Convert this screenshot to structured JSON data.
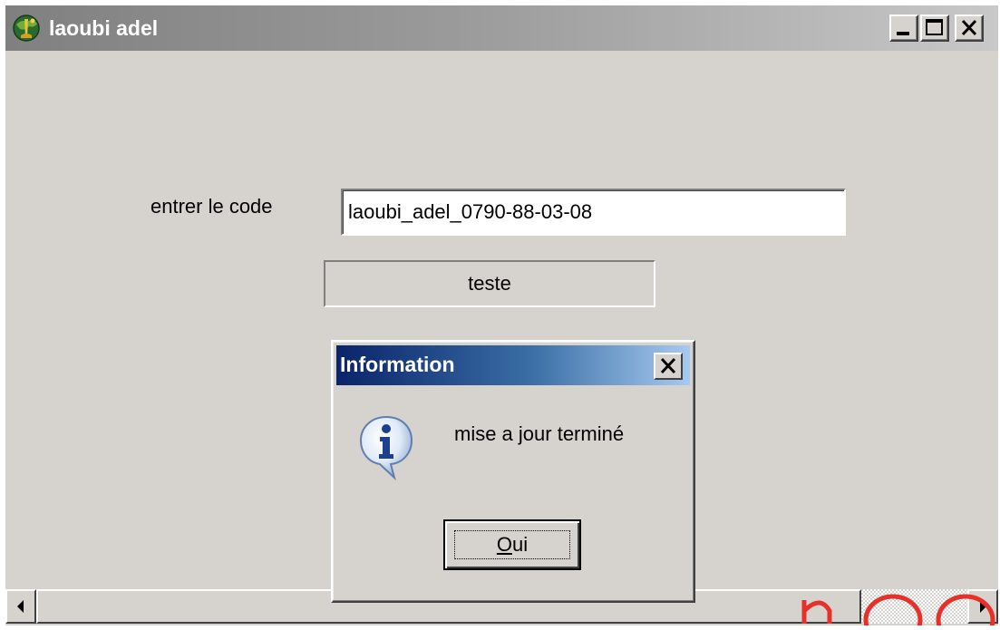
{
  "window": {
    "title": "laoubi adel",
    "icon": "app-icon",
    "controls": [
      "minimize-icon",
      "maximize-icon",
      "close-icon"
    ]
  },
  "form": {
    "code_label": "entrer le code",
    "code_value": "laoubi_adel_0790-88-03-08",
    "test_button_label": "teste"
  },
  "dialog": {
    "title": "Information",
    "icon": "info-icon",
    "message": "mise a jour terminé",
    "ok_button_mnemonic": "O",
    "ok_button_rest": "ui"
  },
  "colors": {
    "window_face": "#d6d3ce",
    "dialog_title_start": "#0a246a",
    "dialog_title_end": "#a6caf0",
    "watermark": "#e8302a"
  }
}
